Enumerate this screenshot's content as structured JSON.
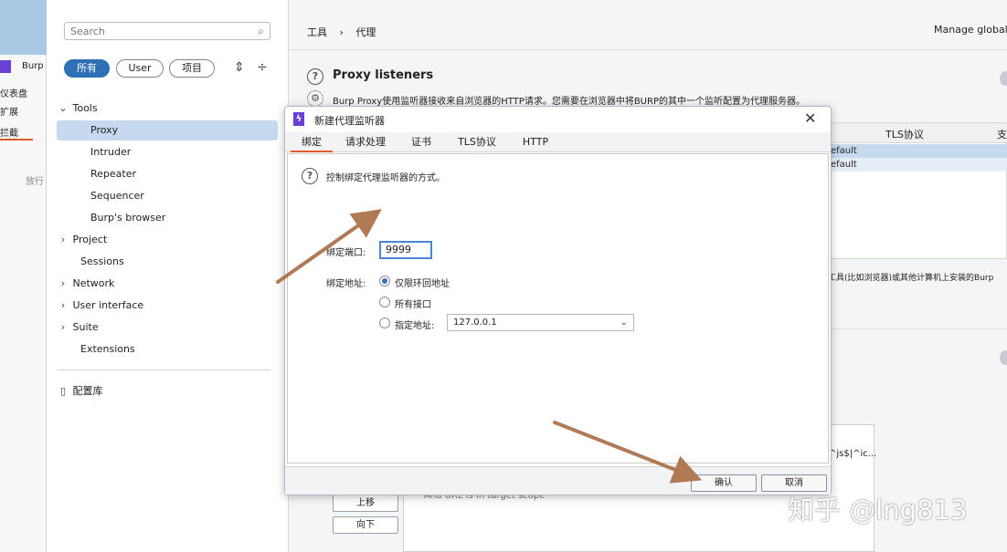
{
  "sidebar_strip": {
    "logo_label": "Burp",
    "items": [
      "仪表盘",
      "扩展",
      "拦截"
    ],
    "forward_label": "放行"
  },
  "settings": {
    "search_placeholder": "Search",
    "filters": [
      "所有",
      "User",
      "项目"
    ],
    "tree": [
      {
        "label": "Tools",
        "expanded": true
      },
      {
        "label": "Proxy",
        "selected": true
      },
      {
        "label": "Intruder"
      },
      {
        "label": "Repeater"
      },
      {
        "label": "Sequencer"
      },
      {
        "label": "Burp's browser"
      },
      {
        "label": "Project",
        "expanded": false
      },
      {
        "label": "Sessions"
      },
      {
        "label": "Network",
        "expanded": false
      },
      {
        "label": "User interface",
        "expanded": false
      },
      {
        "label": "Suite",
        "expanded": false
      },
      {
        "label": "Extensions"
      }
    ],
    "library_label": "配置库"
  },
  "main": {
    "breadcrumb": [
      "工具",
      "代理"
    ],
    "manage_label": "Manage global s",
    "section_title": "Proxy listeners",
    "section_desc": "Burp Proxy使用监听器接收来自浏览器的HTTP请求。您需要在浏览器中将BURP的其中一个监听配置为代理服务器。",
    "table_headers": [
      "TLS协议",
      "支"
    ],
    "table_rows": [
      "efault",
      "efault"
    ],
    "desc2": "工具(比如浏览器)或其他计算机上安装的Burp",
    "bg_table_cut": "^js$|^ic...",
    "bg_table_row": "And        URL        Is in target scope",
    "side_buttons": [
      "上移",
      "向下"
    ]
  },
  "dialog": {
    "title": "新建代理监听器",
    "tabs": [
      "绑定",
      "请求处理",
      "证书",
      "TLS协议",
      "HTTP"
    ],
    "active_tab": 0,
    "help_text": "控制绑定代理监听器的方式。",
    "port_label": "绑定端口:",
    "port_value": "9999",
    "addr_label": "绑定地址:",
    "addr_options": [
      "仅限环回地址",
      "所有接口",
      "指定地址:"
    ],
    "selected_option": 0,
    "specific_addr_value": "127.0.0.1",
    "ok_label": "确认",
    "cancel_label": "取消"
  },
  "watermark": "知乎 @lng813",
  "colors": {
    "accent": "#2f6fb5",
    "arrow": "#b07a55",
    "selection": "#c7d9ef",
    "logo": "#6a3fd6"
  }
}
